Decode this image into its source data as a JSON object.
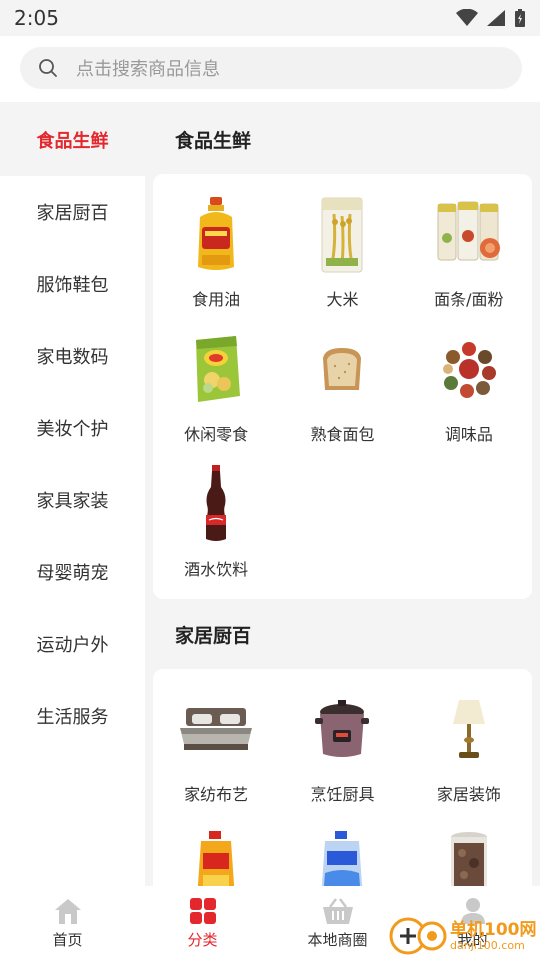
{
  "status": {
    "time": "2:05"
  },
  "search": {
    "placeholder": "点击搜索商品信息"
  },
  "sidebar": {
    "items": [
      {
        "label": "食品生鲜",
        "active": true
      },
      {
        "label": "家居厨百"
      },
      {
        "label": "服饰鞋包"
      },
      {
        "label": "家电数码"
      },
      {
        "label": "美妆个护"
      },
      {
        "label": "家具家装"
      },
      {
        "label": "母婴萌宠"
      },
      {
        "label": "运动户外"
      },
      {
        "label": "生活服务"
      }
    ]
  },
  "sections": [
    {
      "title": "食品生鲜",
      "items": [
        {
          "label": "食用油",
          "icon": "oil-bottle-icon"
        },
        {
          "label": "大米",
          "icon": "rice-bag-icon"
        },
        {
          "label": "面条/面粉",
          "icon": "noodles-icon"
        },
        {
          "label": "休闲零食",
          "icon": "chips-bag-icon"
        },
        {
          "label": "熟食面包",
          "icon": "bread-icon"
        },
        {
          "label": "调味品",
          "icon": "spices-icon"
        },
        {
          "label": "酒水饮料",
          "icon": "cola-bottle-icon"
        }
      ]
    },
    {
      "title": "家居厨百",
      "items": [
        {
          "label": "家纺布艺",
          "icon": "bed-icon"
        },
        {
          "label": "烹饪厨具",
          "icon": "pressure-cooker-icon"
        },
        {
          "label": "家居装饰",
          "icon": "table-lamp-icon"
        },
        {
          "label": "",
          "icon": "detergent-bottle-icon"
        },
        {
          "label": "",
          "icon": "laundry-liquid-icon"
        },
        {
          "label": "",
          "icon": "storage-jar-icon"
        }
      ]
    }
  ],
  "tabs": [
    {
      "label": "首页",
      "icon": "home-icon"
    },
    {
      "label": "分类",
      "icon": "category-icon",
      "active": true
    },
    {
      "label": "本地商圈",
      "icon": "basket-icon"
    },
    {
      "label": "我的",
      "icon": "user-icon"
    }
  ],
  "watermark": {
    "text": "单机100网",
    "sub": "danji100.com"
  },
  "colors": {
    "accent": "#e4262d",
    "background": "#f4f4f4"
  }
}
